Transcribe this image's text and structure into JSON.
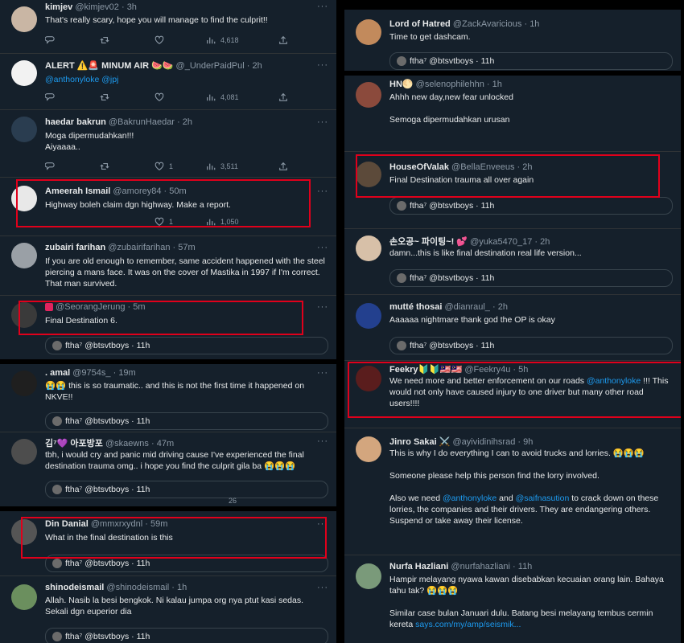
{
  "left": {
    "tweets": [
      {
        "name": "kimjev",
        "handle": "@kimjev02",
        "time": "3h",
        "text": "That's really scary, hope you will manage to find the culprit!!",
        "views": "4,618"
      },
      {
        "name": "ALERT ⚠️🚨 MINUM AIR 🍉🍉",
        "handle": "@_UnderPaidPul",
        "time": "2h",
        "mention1": "@anthonyloke",
        "mention2": "@jpj",
        "views": "4,081"
      },
      {
        "name": "haedar bakrun",
        "handle": "@BakrunHaedar",
        "time": "2h",
        "line1": "Moga dipermudahkan!!!",
        "line2": "Aiyaaaa..",
        "likes": "1",
        "views": "3,511"
      },
      {
        "name": "Ameerah Ismail",
        "handle": "@amorey84",
        "time": "50m",
        "text": "Highway boleh claim dgn highway. Make a report.",
        "likes": "1",
        "views": "1,050"
      },
      {
        "name": "zubairi farihan",
        "handle": "@zubairifarihan",
        "time": "57m",
        "text": "If you are old enough to remember, same accident happened  with the steel piercing a mans face. It was on the cover of Mastika in 1997 if I'm correct. That man survived."
      },
      {
        "name": "🅰️",
        "handle": "@SeorangJerung",
        "time": "5m",
        "text": "Final Destination 6.",
        "quote": "ftha⁷ @btsvtboys · 11h"
      },
      {
        "name": ". amal",
        "handle": "@9754s_",
        "time": "19m",
        "text": "😭😭 this is so traumatic.. and this is not the first time it happened on NKVE!!",
        "quote": "ftha⁷ @btsvtboys · 11h"
      },
      {
        "name": "김⁷💜 아포방포",
        "handle": "@skaewns",
        "time": "47m",
        "text": "tbh, i would cry and panic mid driving cause I've experienced the final destination trauma omg.. i hope you find the culprit gila ba 😭😭😭",
        "quote": "ftha⁷ @btsvtboys · 11h",
        "partial": "26"
      },
      {
        "name": "Din Danial",
        "handle": "@mmxrxydnl",
        "time": "59m",
        "text": "What in the final destination is this",
        "quote": "ftha⁷ @btsvtboys · 11h"
      },
      {
        "name": "shinodeismail",
        "handle": "@shinodeismail",
        "time": "1h",
        "line1": "Allah. Nasib la besi bengkok. Ni kalau jumpa org nya ptut kasi sedas.",
        "line2": "Sekali dgn euperior dia",
        "quote": "ftha⁷ @btsvtboys · 11h"
      }
    ]
  },
  "right": {
    "tweets": [
      {
        "name": "Lord of Hatred",
        "handle": "@ZackAvaricious",
        "time": "1h",
        "text": "Time to get dashcam.",
        "quote": "ftha⁷ @btsvtboys · 11h"
      },
      {
        "name": "HN🌕",
        "handle": "@selenophilehhn",
        "time": "1h",
        "line1": "Ahhh new day,new fear unlocked",
        "line2": "Semoga dipermudahkan urusan"
      },
      {
        "name": "HouseOfValak",
        "handle": "@BellaEnveeus",
        "time": "2h",
        "text": "Final Destination trauma all over again",
        "quote": "ftha⁷ @btsvtboys · 11h"
      },
      {
        "name": "손오공~ 파이팅~! 💕",
        "handle": "@yuka5470_17",
        "time": "2h",
        "text": "damn...this is like final destination real life version...",
        "quote": "ftha⁷ @btsvtboys · 11h"
      },
      {
        "name": "mutté thosai",
        "handle": "@dianraul_",
        "time": "2h",
        "text": "Aaaaaa nightmare thank god the OP is okay",
        "quote": "ftha⁷ @btsvtboys · 11h"
      },
      {
        "name": "Feekry🔰🔰🇲🇾🇲🇾",
        "handle": "@Feekry4u",
        "time": "5h",
        "text_a": "We need more and better enforcement on our roads ",
        "mention": "@anthonyloke",
        "text_b": " !!! This would not only have caused injury to one driver but many other road users!!!!"
      },
      {
        "name": "Jinro Sakai ⚔️",
        "handle": "@ayividinihsrad",
        "time": "9h",
        "line1": "This is why I do everything I can to avoid trucks and lorries. 😭😭😭",
        "line2": "Someone please help this person find the lorry involved.",
        "l3a": "Also we need ",
        "m1": "@anthonyloke",
        "l3b": " and ",
        "m2": "@saifnasution",
        "l3c": " to crack down on these lorries, the companies and their drivers. They are endangering others. Suspend or take away their license."
      },
      {
        "name": "Nurfa Hazliani",
        "handle": "@nurfahazliani",
        "time": "11h",
        "line1": "Hampir melayang nyawa kawan disebabkan kecuaian orang lain. Bahaya tahu tak? 😭😭😭",
        "line2": "Similar case bulan Januari dulu. Batang besi melayang tembus cermin kereta ",
        "link": "says.com/my/amp/seismik..."
      }
    ]
  },
  "colors": {
    "bg": "#15202b",
    "text": "#e7e9ea",
    "muted": "#8b98a5",
    "link": "#1d9bf0",
    "highlight": "#e0001b",
    "divider": "#2f3336"
  },
  "icons": [
    "reply-icon",
    "retweet-icon",
    "like-icon",
    "views-icon",
    "share-icon",
    "more-icon"
  ]
}
